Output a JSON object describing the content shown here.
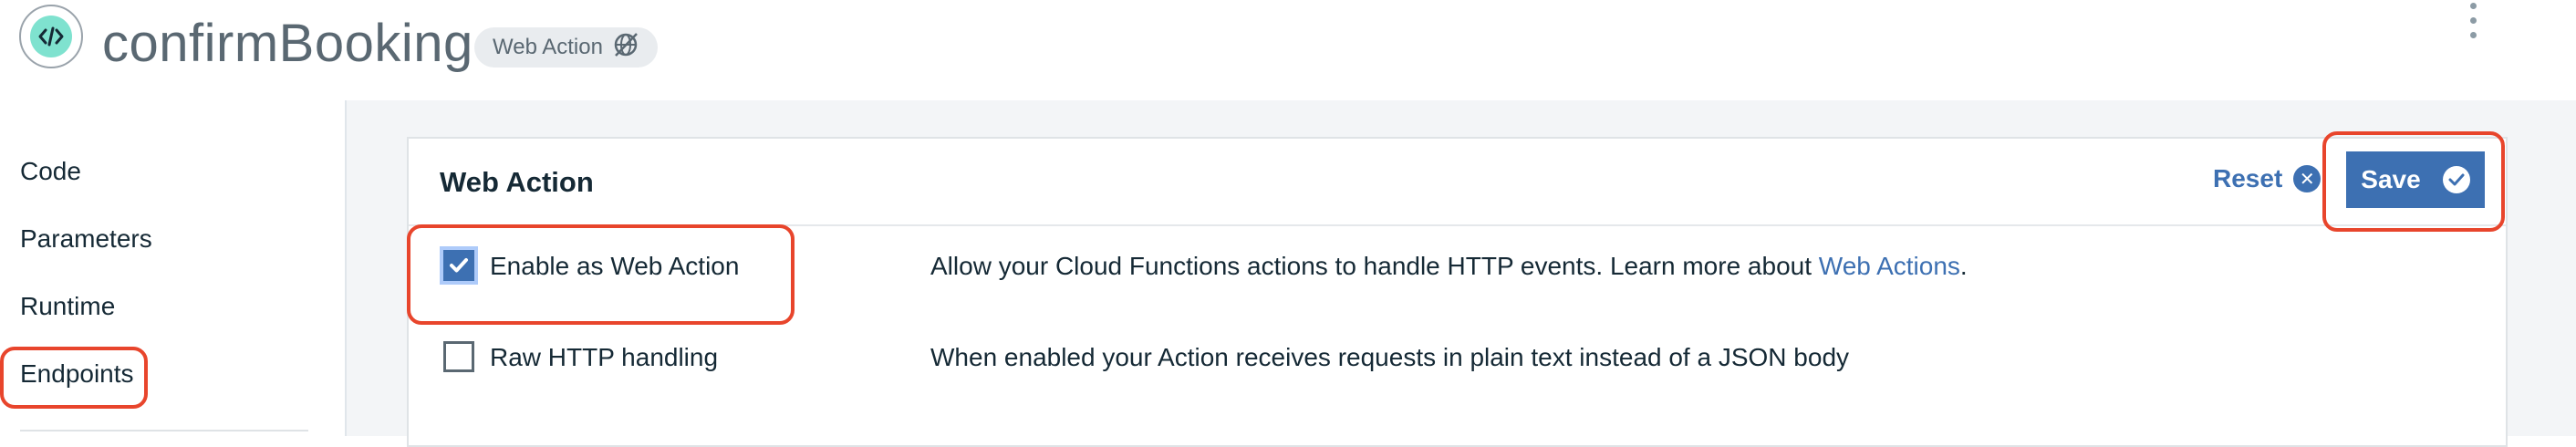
{
  "header": {
    "title": "confirmBooking",
    "badge": "Web Action"
  },
  "sidebar": {
    "items": [
      {
        "label": "Code"
      },
      {
        "label": "Parameters"
      },
      {
        "label": "Runtime"
      },
      {
        "label": "Endpoints"
      }
    ]
  },
  "card": {
    "title": "Web Action",
    "reset_label": "Reset",
    "save_label": "Save",
    "rows": [
      {
        "label": "Enable as Web Action",
        "checked": true,
        "description": "Allow your Cloud Functions actions to handle HTTP events. Learn more about ",
        "link": "Web Actions",
        "trailing": "."
      },
      {
        "label": "Raw HTTP handling",
        "checked": false,
        "description": "When enabled your Action receives requests in plain text instead of a JSON body"
      }
    ]
  },
  "colors": {
    "accent": "#3d70b2",
    "highlight": "#e8452c",
    "icon_bg": "#7fe2cf"
  },
  "icons": [
    "code-icon",
    "web-action-disabled-icon",
    "kebab-menu-icon",
    "reset-x-icon",
    "save-check-icon",
    "checkmark-icon"
  ]
}
